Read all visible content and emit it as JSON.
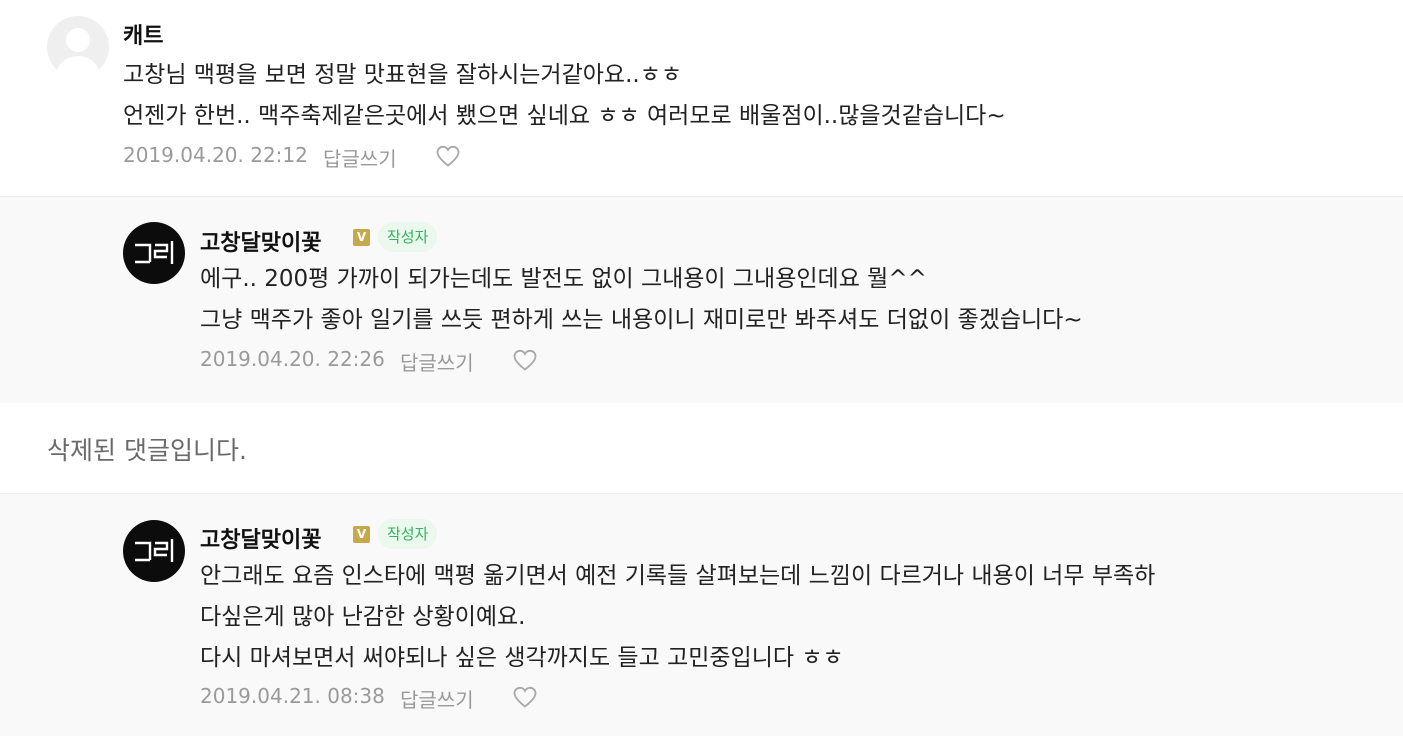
{
  "comments": [
    {
      "author": "캐트",
      "lines": [
        "고창님 맥평을 보면 정말 맛표현을 잘하시는거같아요..ㅎㅎ",
        "언젠가 한번.. 맥주축제같은곳에서 뵀으면 싶네요 ㅎㅎ 여러모로 배울점이..많을것같습니다~"
      ],
      "date": "2019.04.20. 22:12",
      "reply_label": "답글쓰기",
      "like_icon": "heart-outline-icon",
      "avatar_icon": "default-user-icon"
    },
    {
      "author": "고창달맞이꽃",
      "verified_mark": "V",
      "writer_tag": "작성자",
      "lines": [
        "에구.. 200평 가까이 되가는데도 발전도 없이 그내용이 그내용인데요 뭘^^",
        "그냥 맥주가 좋아 일기를 쓰듯 편하게 쓰는 내용이니 재미로만 봐주셔도 더없이 좋겠습니다~"
      ],
      "date": "2019.04.20. 22:26",
      "reply_label": "답글쓰기",
      "like_icon": "heart-outline-icon",
      "avatar_icon": "gochang-logo-icon"
    },
    {
      "deleted_text": "삭제된 댓글입니다."
    },
    {
      "author": "고창달맞이꽃",
      "verified_mark": "V",
      "writer_tag": "작성자",
      "lines": [
        "안그래도 요즘 인스타에 맥평 옮기면서 예전 기록들 살펴보는데 느낌이 다르거나 내용이 너무 부족하",
        "다싶은게 많아 난감한 상황이예요.",
        "다시 마셔보면서 써야되나 싶은 생각까지도 들고 고민중입니다 ㅎㅎ"
      ],
      "date": "2019.04.21. 08:38",
      "reply_label": "답글쓰기",
      "like_icon": "heart-outline-icon",
      "avatar_icon": "gochang-logo-icon"
    }
  ],
  "colors": {
    "reply_background": "#f9f9f9",
    "writer_tag_bg": "#eaf8ee",
    "writer_tag_text": "#32b45a",
    "verified_badge": "#c6a94a",
    "meta_text": "#9a9a9a",
    "deleted_text": "#6a6a6a"
  }
}
